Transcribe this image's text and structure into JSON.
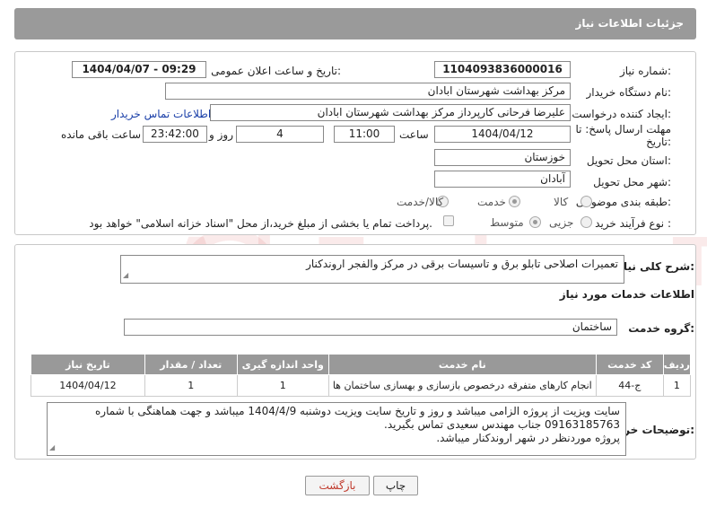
{
  "header": {
    "title": "جزئیات اطلاعات نیاز"
  },
  "form": {
    "need_number_label": "شماره نیاز:",
    "need_number": "1104093836000016",
    "announce_label": "تاریخ و ساعت اعلان عمومی:",
    "announce_value": "1404/04/07 - 09:29",
    "buyer_org_label": "نام دستگاه خریدار:",
    "buyer_org": "مرکز بهداشت شهرستان ابادان",
    "creator_label": "ایجاد کننده درخواست:",
    "creator": "علیرضا فرحانی کارپرداز مرکز بهداشت شهرستان ابادان",
    "contact_link": "اطلاعات تماس خریدار",
    "deadline_label": "مهلت ارسال پاسخ: تا تاریخ:",
    "deadline_date": "1404/04/12",
    "time_label": "ساعت",
    "deadline_time": "11:00",
    "days_value": "4",
    "days_label": "روز و",
    "remaining_time": "23:42:00",
    "remaining_label": "ساعت باقی مانده",
    "province_label": "استان محل تحویل:",
    "province": "خوزستان",
    "city_label": "شهر محل تحویل:",
    "city": "آبادان",
    "category_label": "طبقه بندی موضوعی:",
    "category_options": [
      "کالا",
      "خدمت",
      "کالا/خدمت"
    ],
    "process_label": "نوع فرآیند خرید :",
    "process_options": [
      "جزیی",
      "متوسط"
    ],
    "payment_note": "پرداخت تمام یا بخشی از مبلغ خرید،از محل \"اسناد خزانه اسلامی\" خواهد بود."
  },
  "summary": {
    "label": "شرح کلی نیاز:",
    "value": "تعمیرات اصلاحی تابلو برق و تاسیسات برقی در مرکز والفجر اروندکنار"
  },
  "services": {
    "section_title": "اطلاعات خدمات مورد نیاز",
    "group_label": "گروه خدمت:",
    "group_value": "ساختمان",
    "columns": [
      "ردیف",
      "کد خدمت",
      "نام خدمت",
      "واحد اندازه گیری",
      "تعداد / مقدار",
      "تاریخ نیاز"
    ],
    "rows": [
      [
        "1",
        "ج-44",
        "انجام کارهای متفرقه درخصوص بازسازی و بهسازی ساختمان ها",
        "1",
        "1",
        "1404/04/12"
      ]
    ]
  },
  "buyer_notes": {
    "label": "توضیحات خریدار:",
    "lines": [
      "سایت ویزیت از پروژه الزامی میباشد و روز و تاریخ سایت ویزیت دوشنبه 1404/4/9 میباشد و جهت هماهنگی با شماره",
      "09163185763 جناب مهندس سعیدی تماس بگیرید.",
      "پروژه موردنظر در شهر اروندکنار میباشد."
    ]
  },
  "buttons": {
    "print": "چاپ",
    "back": "بازگشت"
  },
  "watermark": "AriaTender.neT"
}
